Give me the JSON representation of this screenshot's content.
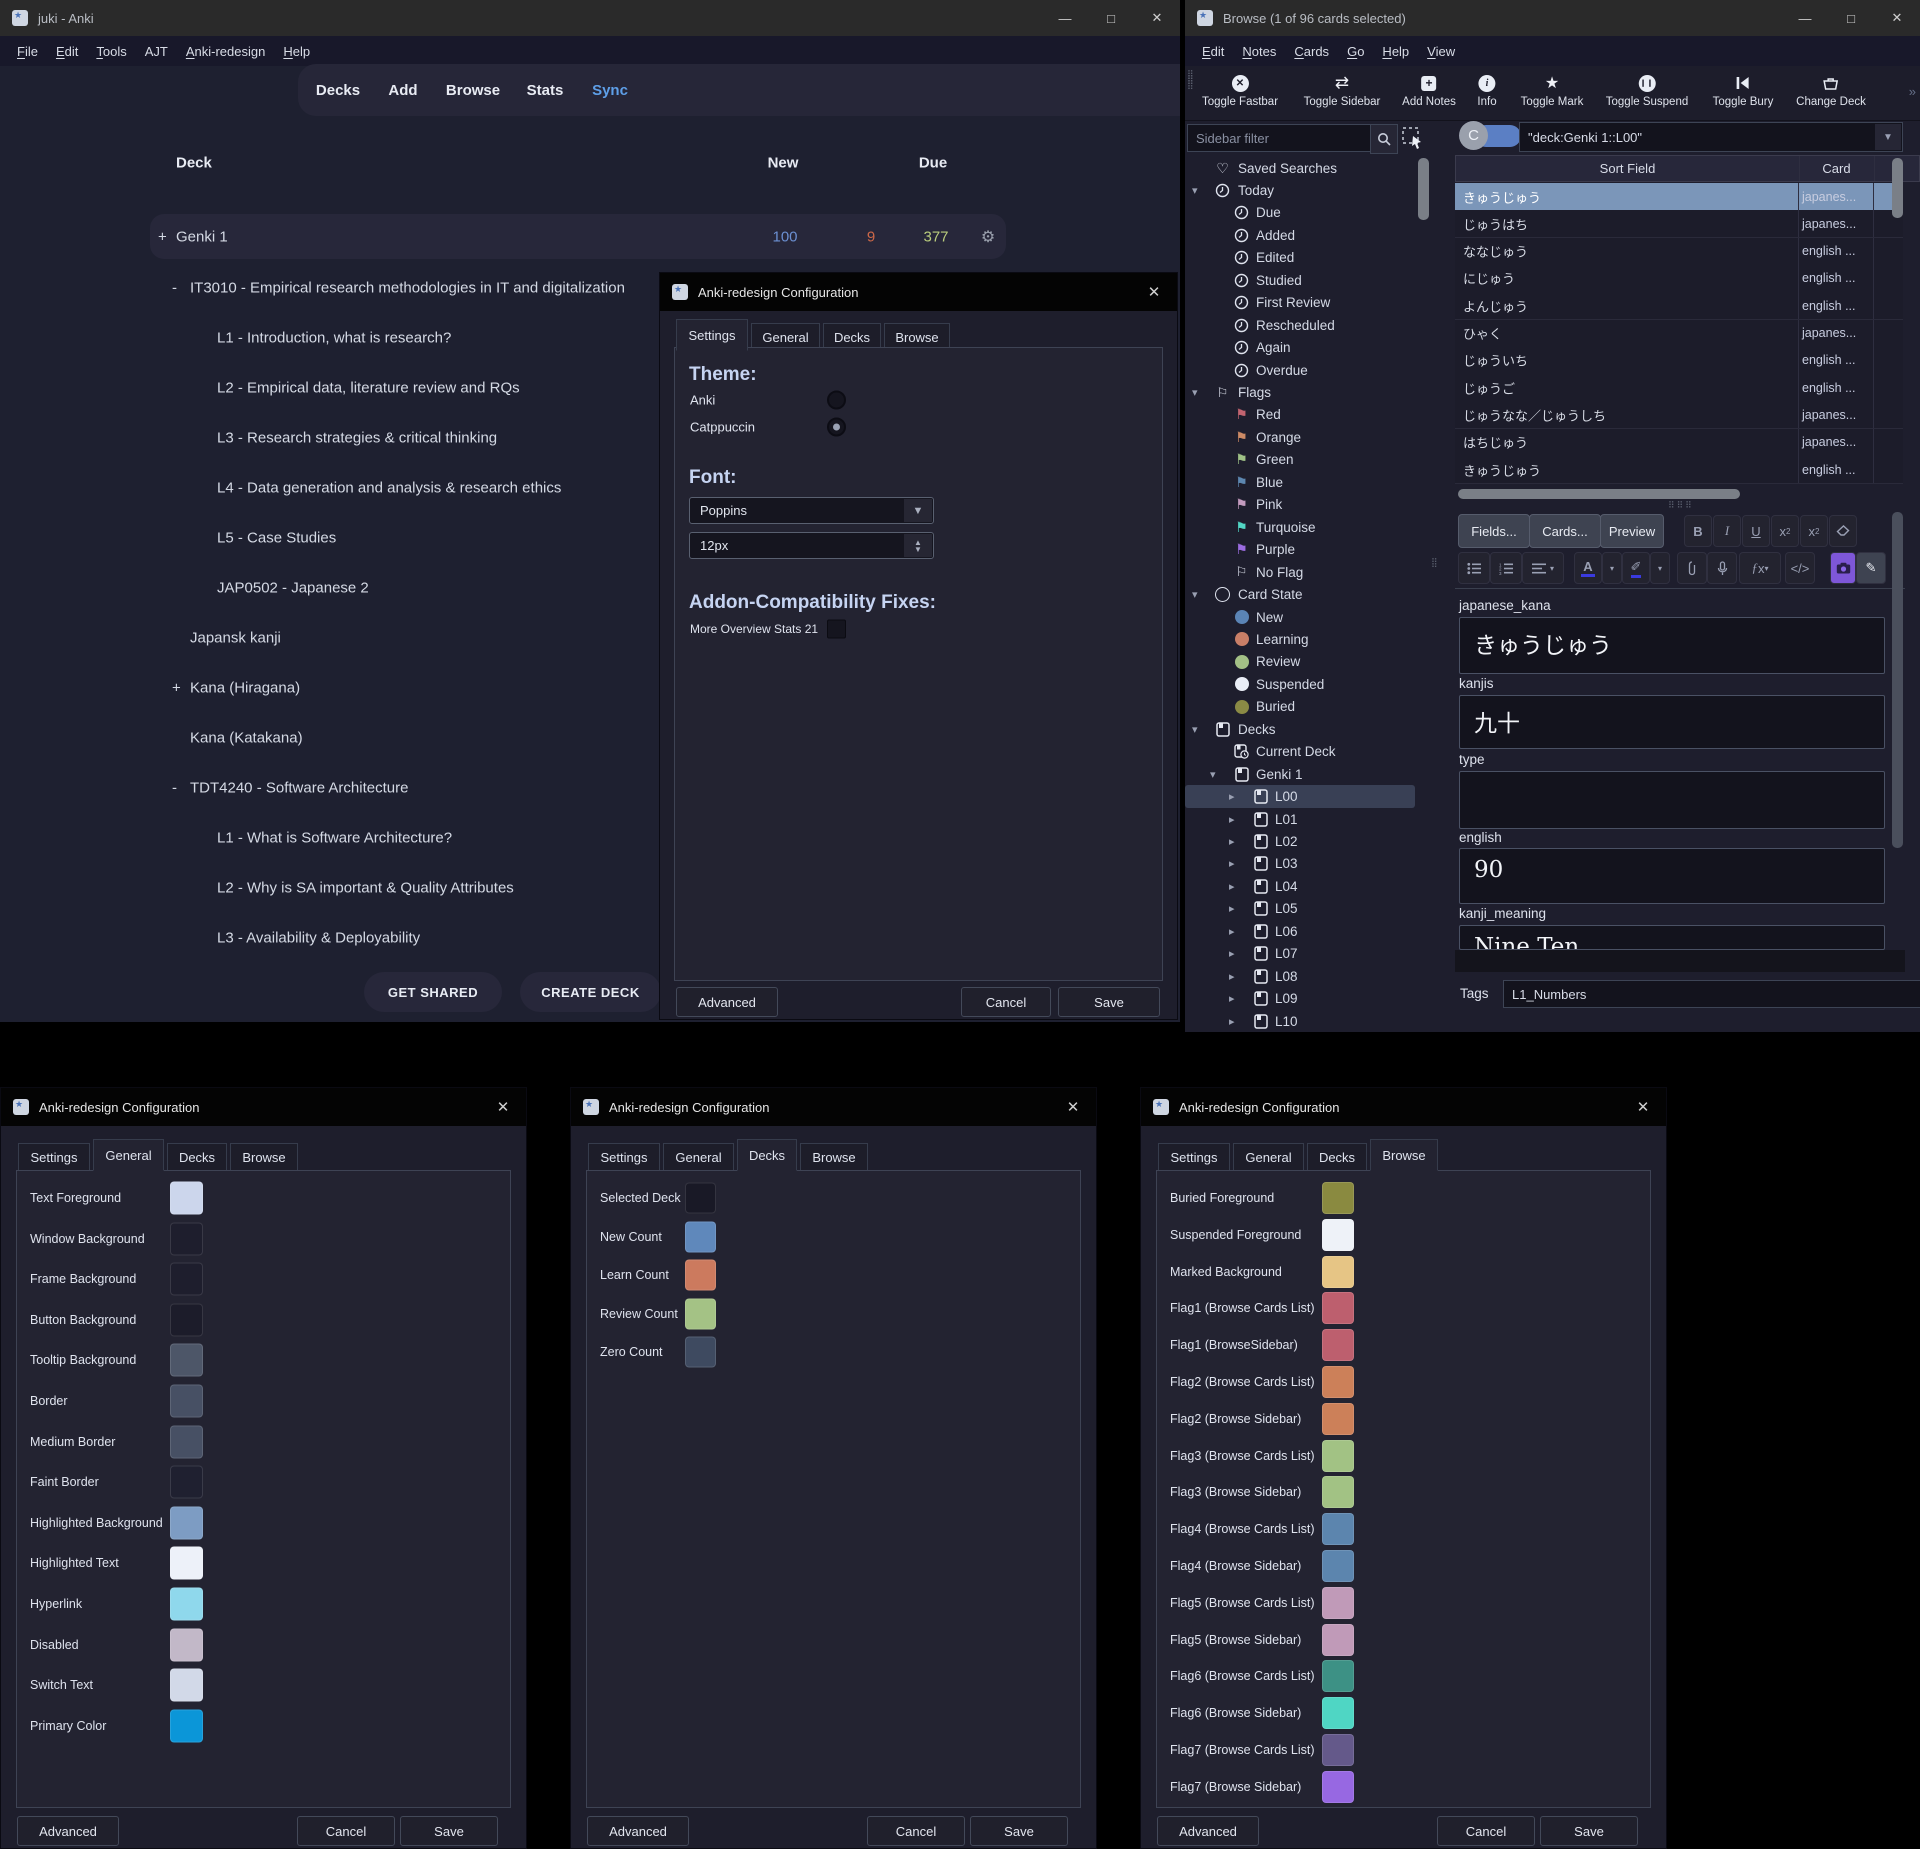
{
  "main_window": {
    "title": "juki - Anki",
    "menu": [
      {
        "label": "File"
      },
      {
        "label": "Edit"
      },
      {
        "label": "Tools"
      },
      {
        "label": "AJT",
        "u": false
      },
      {
        "label": "Anki-redesign"
      },
      {
        "label": "Help"
      }
    ],
    "nav": [
      "Decks",
      "Add",
      "Browse",
      "Stats",
      "Sync"
    ],
    "nav_active": "Sync",
    "columns": {
      "deck": "Deck",
      "new": "New",
      "due": "Due"
    },
    "genki_row": {
      "prefix": "+",
      "name": "Genki 1",
      "new_count": "100",
      "learn_count": "9",
      "due_count": "377"
    },
    "count_colors": {
      "new": "#6b8fd1",
      "learn": "#cd6848",
      "due": "#b9cc7d"
    },
    "deck_tree": [
      {
        "prefix": "-",
        "name": "IT3010 - Empirical research methodologies in IT and digitalization",
        "level": 0
      },
      {
        "name": "L1 - Introduction, what is research?",
        "level": 1
      },
      {
        "name": "L2 - Empirical data, literature review and RQs",
        "level": 1
      },
      {
        "name": "L3 - Research strategies & critical thinking",
        "level": 1
      },
      {
        "name": "L4 - Data generation and analysis & research ethics",
        "level": 1
      },
      {
        "name": "L5 - Case Studies",
        "level": 1
      },
      {
        "name": "JAP0502 - Japanese 2",
        "level": 1
      },
      {
        "name": "Japansk kanji",
        "level": 0
      },
      {
        "prefix": "+",
        "name": "Kana (Hiragana)",
        "level": 0
      },
      {
        "name": "Kana (Katakana)",
        "level": 0
      },
      {
        "prefix": "-",
        "name": "TDT4240 - Software Architecture",
        "level": 0
      },
      {
        "name": "L1 - What is Software Architecture?",
        "level": 1
      },
      {
        "name": "L2 - Why is SA important & Quality Attributes",
        "level": 1
      },
      {
        "name": "L3 - Availability & Deployability",
        "level": 1
      }
    ],
    "get_shared_label": "GET SHARED",
    "create_deck_label": "CREATE DECK"
  },
  "browse_window": {
    "title": "Browse (1 of 96 cards selected)",
    "menu": [
      {
        "label": "Edit"
      },
      {
        "label": "Notes"
      },
      {
        "label": "Cards"
      },
      {
        "label": "Go"
      },
      {
        "label": "Help"
      },
      {
        "label": "View"
      }
    ],
    "fastbar": [
      {
        "icon": "circle-x",
        "label": "Toggle Fastbar"
      },
      {
        "icon": "swap-arrows",
        "label": "Toggle Sidebar"
      },
      {
        "icon": "plus-square",
        "label": "Add Notes"
      },
      {
        "icon": "info-circle",
        "label": "Info"
      },
      {
        "icon": "star",
        "label": "Toggle Mark"
      },
      {
        "icon": "pause-circle",
        "label": "Toggle Suspend"
      },
      {
        "icon": "bury",
        "label": "Toggle Bury"
      },
      {
        "icon": "change-deck",
        "label": "Change Deck"
      }
    ],
    "sidebar_filter_placeholder": "Sidebar filter",
    "toggle_badge": "C",
    "search_value": "\"deck:Genki 1::L00\"",
    "sidebar": [
      {
        "icon": "heart",
        "label": "Saved Searches",
        "depth": 0
      },
      {
        "caret": "down",
        "icon": "clock",
        "label": "Today",
        "depth": 0
      },
      {
        "icon": "clock",
        "label": "Due",
        "depth": 1
      },
      {
        "icon": "clock",
        "label": "Added",
        "depth": 1
      },
      {
        "icon": "clock",
        "label": "Edited",
        "depth": 1
      },
      {
        "icon": "clock",
        "label": "Studied",
        "depth": 1
      },
      {
        "icon": "clock",
        "label": "First Review",
        "depth": 1
      },
      {
        "icon": "clock",
        "label": "Rescheduled",
        "depth": 1
      },
      {
        "icon": "clock",
        "label": "Again",
        "depth": 1
      },
      {
        "icon": "clock",
        "label": "Overdue",
        "depth": 1
      },
      {
        "caret": "down",
        "icon": "flag-outline",
        "label": "Flags",
        "depth": 0
      },
      {
        "icon": "flag",
        "color": "#c26470",
        "label": "Red",
        "depth": 1
      },
      {
        "icon": "flag",
        "color": "#cc8a65",
        "label": "Orange",
        "depth": 1
      },
      {
        "icon": "flag",
        "color": "#9fc186",
        "label": "Green",
        "depth": 1
      },
      {
        "icon": "flag",
        "color": "#5d87b0",
        "label": "Blue",
        "depth": 1
      },
      {
        "icon": "flag",
        "color": "#c39bbe",
        "label": "Pink",
        "depth": 1
      },
      {
        "icon": "flag",
        "color": "#52d6c4",
        "label": "Turquoise",
        "depth": 1
      },
      {
        "icon": "flag",
        "color": "#9b6ce0",
        "label": "Purple",
        "depth": 1
      },
      {
        "icon": "flag-outline",
        "label": "No Flag",
        "depth": 1
      },
      {
        "caret": "down",
        "icon": "circle-outline",
        "label": "Card State",
        "depth": 0
      },
      {
        "icon": "dot",
        "color": "#5b84b5",
        "label": "New",
        "depth": 1
      },
      {
        "icon": "dot",
        "color": "#c97f67",
        "label": "Learning",
        "depth": 1
      },
      {
        "icon": "dot",
        "color": "#a3c086",
        "label": "Review",
        "depth": 1
      },
      {
        "icon": "dot",
        "color": "#e9edf6",
        "label": "Suspended",
        "depth": 1
      },
      {
        "icon": "dot",
        "color": "#8a8a45",
        "label": "Buried",
        "depth": 1
      },
      {
        "caret": "down",
        "icon": "deck",
        "label": "Decks",
        "depth": 0
      },
      {
        "icon": "current-deck",
        "label": "Current Deck",
        "depth": 1
      },
      {
        "caret": "down",
        "icon": "deck",
        "label": "Genki 1",
        "depth": 1
      },
      {
        "caret": "right",
        "icon": "deck",
        "label": "L00",
        "depth": 2,
        "selected": true
      },
      {
        "caret": "right",
        "icon": "deck",
        "label": "L01",
        "depth": 2
      },
      {
        "caret": "right",
        "icon": "deck",
        "label": "L02",
        "depth": 2
      },
      {
        "caret": "right",
        "icon": "deck",
        "label": "L03",
        "depth": 2
      },
      {
        "caret": "right",
        "icon": "deck",
        "label": "L04",
        "depth": 2
      },
      {
        "caret": "right",
        "icon": "deck",
        "label": "L05",
        "depth": 2
      },
      {
        "caret": "right",
        "icon": "deck",
        "label": "L06",
        "depth": 2
      },
      {
        "caret": "right",
        "icon": "deck",
        "label": "L07",
        "depth": 2
      },
      {
        "caret": "right",
        "icon": "deck",
        "label": "L08",
        "depth": 2
      },
      {
        "caret": "right",
        "icon": "deck",
        "label": "L09",
        "depth": 2
      },
      {
        "caret": "right",
        "icon": "deck",
        "label": "L10",
        "depth": 2
      }
    ],
    "table": {
      "columns": [
        "Sort Field",
        "Card"
      ],
      "rows": [
        {
          "sort": "きゅうじゅう",
          "card": "japanes...",
          "selected": true
        },
        {
          "sort": "じゅうはち",
          "card": "japanes..."
        },
        {
          "sort": "ななじゅう",
          "card": "english ..."
        },
        {
          "sort": "にじゅう",
          "card": "english ..."
        },
        {
          "sort": "よんじゅう",
          "card": "english ..."
        },
        {
          "sort": "ひゃく",
          "card": "japanes..."
        },
        {
          "sort": "じゅういち",
          "card": "english ..."
        },
        {
          "sort": "じゅうご",
          "card": "english ..."
        },
        {
          "sort": "じゅうなな／じゅうしち",
          "card": "japanes..."
        },
        {
          "sort": "はちじゅう",
          "card": "japanes..."
        },
        {
          "sort": "きゅうじゅう",
          "card": "english ..."
        }
      ]
    },
    "editor": {
      "buttons": [
        "Fields...",
        "Cards...",
        "Preview"
      ],
      "format_row1": [
        "B",
        "I",
        "U",
        "x2sup",
        "x2sub",
        "eraser"
      ],
      "fields": [
        {
          "label": "japanese_kana",
          "value": "きゅうじゅう"
        },
        {
          "label": "kanjis",
          "value": "九十"
        },
        {
          "label": "type",
          "value": ""
        },
        {
          "label": "english",
          "value": "90",
          "serif": true
        },
        {
          "label": "kanji_meaning",
          "value": "Nine Ten",
          "serif": true,
          "clipped": true
        }
      ],
      "tags_label": "Tags",
      "tags_value": "L1_Numbers"
    }
  },
  "dialog_tabs": [
    "Settings",
    "General",
    "Decks",
    "Browse"
  ],
  "dialog_buttons": {
    "advanced": "Advanced",
    "cancel": "Cancel",
    "save": "Save"
  },
  "settings_dialog": {
    "title": "Anki-redesign Configuration",
    "active_tab": "Settings",
    "theme_label": "Theme:",
    "theme_options": [
      {
        "label": "Anki",
        "selected": false
      },
      {
        "label": "Catppuccin",
        "selected": true
      }
    ],
    "font_label": "Font:",
    "font_value": "Poppins",
    "font_size_value": "12px",
    "addon_label": "Addon-Compatibility Fixes:",
    "addon_checkbox": {
      "label": "More Overview Stats 21",
      "checked": false
    }
  },
  "general_dialog": {
    "title": "Anki-redesign Configuration",
    "active_tab": "General",
    "rows": [
      {
        "label": "Text Foreground",
        "color": "#ccd6ec"
      },
      {
        "label": "Window Background",
        "color": "#1e1e2d"
      },
      {
        "label": "Frame Background",
        "color": "#1e1e2d"
      },
      {
        "label": "Button Background",
        "color": "#1c1c2a"
      },
      {
        "label": "Tooltip Background",
        "color": "#4d5668"
      },
      {
        "label": "Border",
        "color": "#475064"
      },
      {
        "label": "Medium Border",
        "color": "#475064"
      },
      {
        "label": "Faint Border",
        "color": "#1f2030"
      },
      {
        "label": "Highlighted Background",
        "color": "#7d9cc3"
      },
      {
        "label": "Highlighted Text",
        "color": "#edf1f9"
      },
      {
        "label": "Hyperlink",
        "color": "#8fd8ec"
      },
      {
        "label": "Disabled",
        "color": "#c2b8c8"
      },
      {
        "label": "Switch Text",
        "color": "#d2d9e8"
      },
      {
        "label": "Primary Color",
        "color": "#0b96d8"
      }
    ]
  },
  "decks_dialog": {
    "title": "Anki-redesign Configuration",
    "active_tab": "Decks",
    "rows": [
      {
        "label": "Selected Deck",
        "color": "#191926"
      },
      {
        "label": "New Count",
        "color": "#5f88bb"
      },
      {
        "label": "Learn Count",
        "color": "#cc7a5e"
      },
      {
        "label": "Review Count",
        "color": "#a4c285"
      },
      {
        "label": "Zero Count",
        "color": "#3e4a60"
      }
    ]
  },
  "browse_dialog": {
    "title": "Anki-redesign Configuration",
    "active_tab": "Browse",
    "rows": [
      {
        "label": "Buried Foreground",
        "color": "#8a8a40"
      },
      {
        "label": "Suspended Foreground",
        "color": "#eef2f8"
      },
      {
        "label": "Marked Background",
        "color": "#e6c585"
      },
      {
        "label": "Flag1 (Browse Cards List)",
        "color": "#bd5f6e"
      },
      {
        "label": "Flag1 (BrowseSidebar)",
        "color": "#bd5f6e"
      },
      {
        "label": "Flag2 (Browse Cards List)",
        "color": "#cc8059"
      },
      {
        "label": "Flag2 (Browse Sidebar)",
        "color": "#cc8059"
      },
      {
        "label": "Flag3 (Browse Cards List)",
        "color": "#a2c284"
      },
      {
        "label": "Flag3 (Browse Sidebar)",
        "color": "#a2c284"
      },
      {
        "label": "Flag4 (Browse Cards List)",
        "color": "#5c85ae"
      },
      {
        "label": "Flag4 (Browse Sidebar)",
        "color": "#5c85ae"
      },
      {
        "label": "Flag5 (Browse Cards List)",
        "color": "#c09ab8"
      },
      {
        "label": "Flag5 (Browse Sidebar)",
        "color": "#c09ab8"
      },
      {
        "label": "Flag6 (Browse Cards List)",
        "color": "#3d9185"
      },
      {
        "label": "Flag6 (Browse Sidebar)",
        "color": "#4fd6c4"
      },
      {
        "label": "Flag7 (Browse Cards List)",
        "color": "#64598a"
      },
      {
        "label": "Flag7 (Browse Sidebar)",
        "color": "#9768e2"
      }
    ]
  }
}
